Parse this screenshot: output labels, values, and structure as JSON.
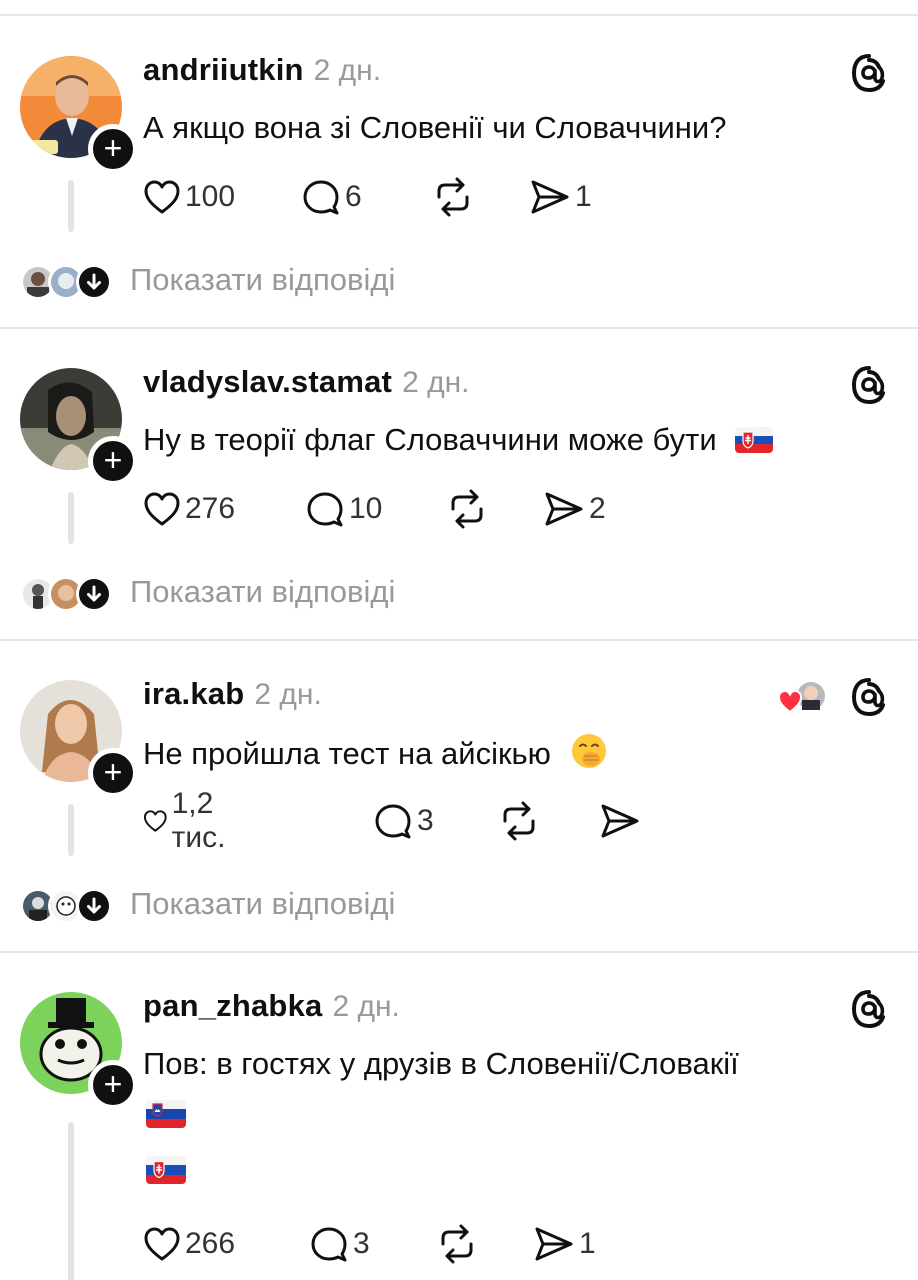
{
  "posts": [
    {
      "username": "andriiutkin",
      "time": "2 дн.",
      "text": "А якщо вона зі Словенії чи Словаччини?",
      "likes": "100",
      "comments": "6",
      "shares": "1",
      "show_replies": "Показати відповіді",
      "avatar_colors": [
        "#f08a3c",
        "#5b3a2a"
      ]
    },
    {
      "username": "vladyslav.stamat",
      "time": "2 дн.",
      "text": "Ну в теорії флаг Словаччини може бути",
      "likes": "276",
      "comments": "10",
      "shares": "2",
      "show_replies": "Показати відповіді",
      "avatar_colors": [
        "#3a3a34",
        "#a8a08a"
      ]
    },
    {
      "username": "ira.kab",
      "time": "2 дн.",
      "text": "Не пройшла тест на айсікью",
      "likes": "1,2 тис.",
      "comments": "3",
      "shares": "",
      "show_replies": "Показати відповіді",
      "avatar_colors": [
        "#e8e2dc",
        "#d8a888"
      ]
    },
    {
      "username": "pan_zhabka",
      "time": "2 дн.",
      "text": "Пов: в гостях у друзів в Словенії/Словакії",
      "likes": "266",
      "comments": "3",
      "shares": "1",
      "avatar_colors": [
        "#7ed35a",
        "#1a1a1a"
      ]
    }
  ],
  "colors": {
    "text": "#101010",
    "muted": "#999999",
    "divider": "#e6e6e6",
    "like_heart": "#ff3040"
  },
  "icons": [
    "heart-icon",
    "comment-icon",
    "repost-icon",
    "share-icon",
    "threads-logo-icon",
    "plus-icon",
    "arrow-down-icon"
  ]
}
